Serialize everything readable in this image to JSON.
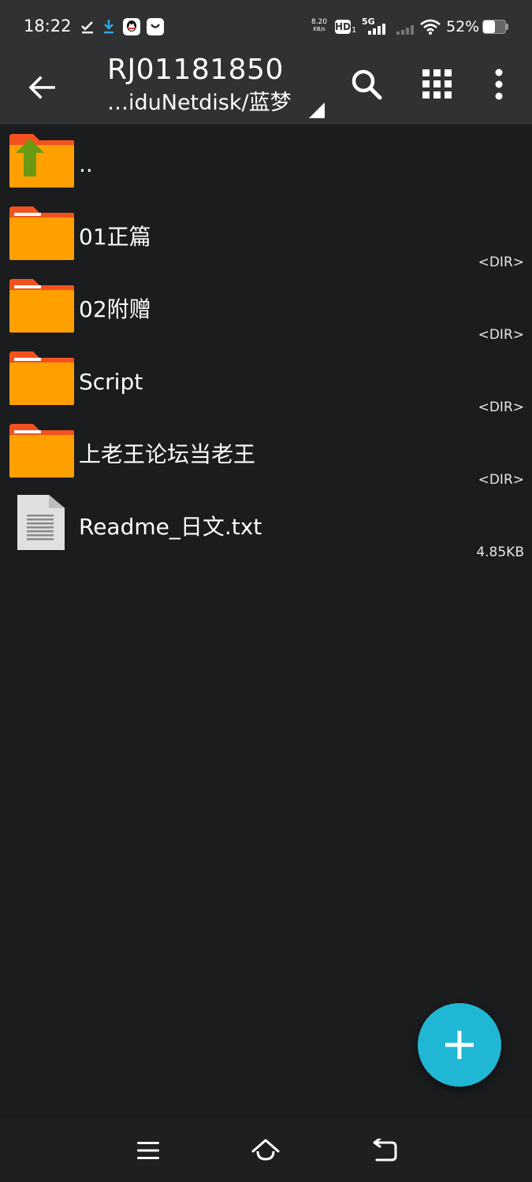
{
  "status_bar": {
    "time": "18:22",
    "net_speed_value": "8.20",
    "net_speed_unit": "KB/s",
    "hd_label": "HD",
    "hd_sub": "1",
    "network_label": "5G",
    "battery_percent": "52%",
    "battery_level": 0.52,
    "notification_icons": [
      "check-icon",
      "download-icon",
      "qq-icon",
      "message-icon"
    ]
  },
  "app_bar": {
    "title": "RJ01181850",
    "subtitle": "…iduNetdisk/蓝梦"
  },
  "files": [
    {
      "name": "..",
      "meta": "",
      "type": "parent-folder"
    },
    {
      "name": "01正篇",
      "meta": "<DIR>",
      "type": "folder"
    },
    {
      "name": "02附赠",
      "meta": "<DIR>",
      "type": "folder"
    },
    {
      "name": "Script",
      "meta": "<DIR>",
      "type": "folder"
    },
    {
      "name": "上老王论坛当老王",
      "meta": "<DIR>",
      "type": "folder"
    },
    {
      "name": "Readme_日文.txt",
      "meta": "4.85KB",
      "type": "text-file"
    }
  ],
  "colors": {
    "bar_background": "#303133",
    "list_background": "#1b1c1e",
    "folder_orange": "#ffa000",
    "folder_tab": "#f4511e",
    "up_arrow_green": "#6b9a12",
    "fab_cyan": "#1fb7d3"
  }
}
